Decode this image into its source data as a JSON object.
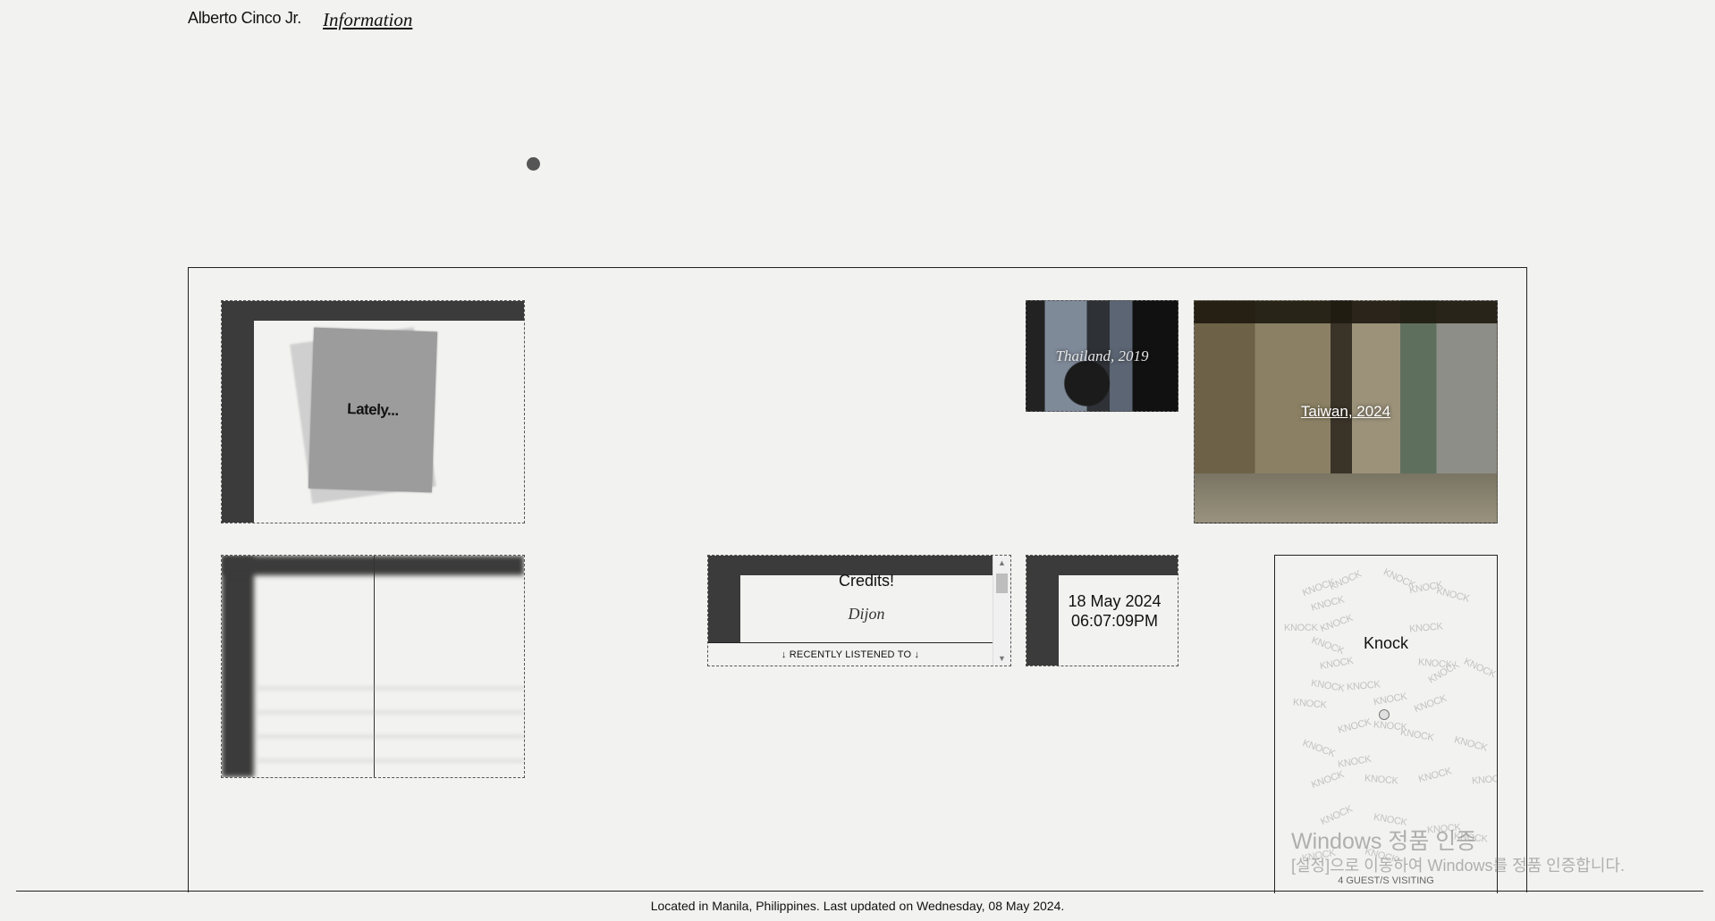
{
  "header": {
    "name": "Alberto Cinco Jr.",
    "info_link": "Information"
  },
  "cards": {
    "lately": {
      "label": "Lately..."
    },
    "thailand": {
      "caption": "Thailand, 2019"
    },
    "taiwan": {
      "caption": "Taiwan, 2024"
    },
    "credits": {
      "title": "Credits!",
      "artist": "Dijon",
      "recent_label": "↓ RECENTLY LISTENED TO ↓"
    },
    "clock": {
      "date": "18 May 2024",
      "time": "06:07:09PM"
    },
    "knock": {
      "title": "Knock",
      "word": "KNOCK",
      "guests": "4 GUEST/S VISITING"
    }
  },
  "footer": {
    "text": "Located in Manila, Philippines. Last updated on Wednesday, 08 May 2024."
  },
  "watermark": {
    "title": "Windows 정품 인증",
    "subtitle": "[설정]으로 이동하여 Windows를 정품 인증합니다."
  },
  "colors": {
    "background": "#f2f2f0",
    "frame_dark": "#3b3b3b",
    "text": "#111111"
  },
  "icons": {
    "scroll_up": "▲",
    "scroll_down": "▼"
  }
}
